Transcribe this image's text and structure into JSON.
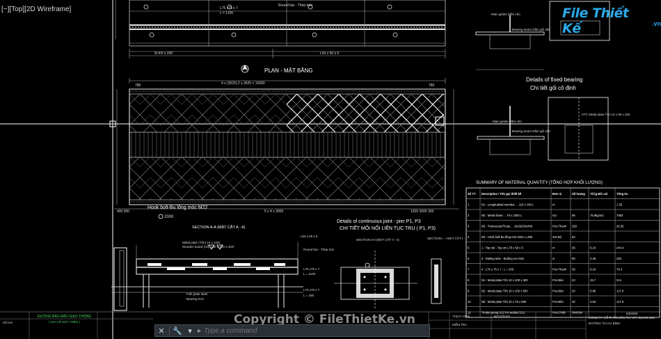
{
  "viewport": {
    "label": "[−][Top][2D Wireframe]"
  },
  "command_line": {
    "prompt": "▸",
    "placeholder": "Type a command",
    "icons": [
      "close-icon",
      "wrench-icon",
      "dropdown-icon"
    ]
  },
  "logo": {
    "name": "File Thiết Kế",
    "domain": ".vn"
  },
  "watermark": "Copyright © FileThietKe.vn",
  "drawing": {
    "top_labels": {
      "round_bar": "Round bar - Thép tròn",
      "l75_top": "L75 x75 x 7",
      "l1100_top": "L = 1100",
      "dim_left": "5t 4/5 x 200",
      "dim_mid": "L55 x 50 x 5"
    },
    "plan_title": "PLAN - MẶT BẰNG",
    "plan_dims": {
      "top": "4 x (3525) 2 x 3525 = 15000",
      "bottom_left": "490 500",
      "bottom_mid": "5 x 4 x 3000",
      "bottom_right": "1200 3000 300",
      "top_small_l": "780",
      "top_small_r": "780"
    },
    "hook_bolt": "Hook bolt-Bu lông móc M22",
    "bolt_dim": "2000",
    "section_aa": "SECTION A-A (MẶT CẮT A - A)",
    "section_ii": "SECTION II-II (MẶT CẮT II - II)",
    "section_i": "SECTION I - I MẶT CẮT I - I",
    "continuous_joint_en": "Details of continuous joint - pier P1, P3",
    "continuous_joint_vn": "CHI TIẾT MỐI NỐI LIÊN TỤC TRỤ ( P1, P3)",
    "fixed_bearing_en": "Details of fixed bearing",
    "fixed_bearing_vn": "Chi tiết gối cố định",
    "main_girder": "Main girder Dầm chủ",
    "bearing_beam": "Bearing beam Dầm gối 400",
    "stc_plate": "STC Metal plate Tôn 10 x 80 x 320",
    "section_aa_labels": {
      "metal_plate": "Metal plate (Tôn) 10 x 100L",
      "wooden_board": "Wooden board (Gỗ) 150 x 300 x 4/20",
      "round_bar2": "Round bar - Thép tròn",
      "l50": "L50 x 50 x 5",
      "l75_a": "L75 x75 x 7",
      "l75_b": "L75 x75 x 7",
      "l_1100": "L = 1100",
      "l_200": "L = 200",
      "fish_plate": "Fish plate steel",
      "bearing_d": "Bearing D12"
    },
    "summary_title": "SUMMARY OF MATERIAL QUANTITY (TỔNG HỢP KHỐI LƯỢNG)",
    "table": {
      "headers": [
        "Số TT",
        "Description / Tên gọi thiết kế",
        "Đơn vị",
        "Số lượng",
        "Tổ.lg M/1 cái",
        "Tổng KL"
      ],
      "rows": [
        [
          "1",
          "N1 : Longitudinal member ... 110 x 100 L",
          "m",
          "",
          "",
          "1.35"
        ],
        [
          "2",
          "N2 : Metal sheet ... 70 x 1000 L",
          "m2",
          "96",
          "75.9kg/m2",
          "7063"
        ],
        [
          "3",
          "N3 : Transverse/Truss ... 10x32/20x450",
          "Pcs-Thanh",
          "320",
          "",
          "28.35"
        ],
        [
          "4",
          "N4 : Hook bolt Bu lông móc M22 L=300",
          "Set-Bộ",
          "64",
          "",
          ""
        ],
        [
          "5",
          "1 : Top rail - Tay vịn L75 x 50 x 5",
          "m",
          "36",
          "6.24",
          "244.4"
        ],
        [
          "6",
          "2 : Railing tube - Bulông ren D28",
          "m",
          "90",
          "2.48",
          "220"
        ],
        [
          "7",
          "4 : L75 x 75 x 7 , L = 200",
          "Pcs-Thanh",
          "36",
          "6.24",
          "78.3"
        ],
        [
          "8",
          "N1 : Metal plate-Tôn 10 x 400 x 300",
          "Pcs-Bản",
          "20",
          "15.7",
          "314"
        ],
        [
          "9",
          "N2 : Metal plate-Tôn 10 x 150 x 500",
          "Pcs-Bản",
          "20",
          "5.86",
          "117.6"
        ],
        [
          "10",
          "N3 : Metal plate-Tôn 10 x 75 x 500",
          "Pcs-Bản",
          "40",
          "2.94",
          "117.6"
        ],
        [
          "12",
          "Timber along D12 for welded D12",
          "Pcs-Chiếc",
          "384/384",
          "",
          ""
        ]
      ]
    },
    "title_block": {
      "left_title": "ĐƯỜNG BẢO ĐẢO GIAO THÔNG",
      "left_sub": "( GIA CỐ MẶT TRÊN )",
      "left_code": "HỒ HÀ",
      "right_a": "THỰC HIỆN",
      "right_b": "NGƯỜI KÝ",
      "right_c": "KIỂM TRA",
      "right_company": "CÔNG TY CỔ PHẦN ĐẦU TƯ XÂY DỰNG 225",
      "right_code": "ĐƯỜNG TẠI HẠ BÌNH",
      "date": "03/2006"
    }
  }
}
